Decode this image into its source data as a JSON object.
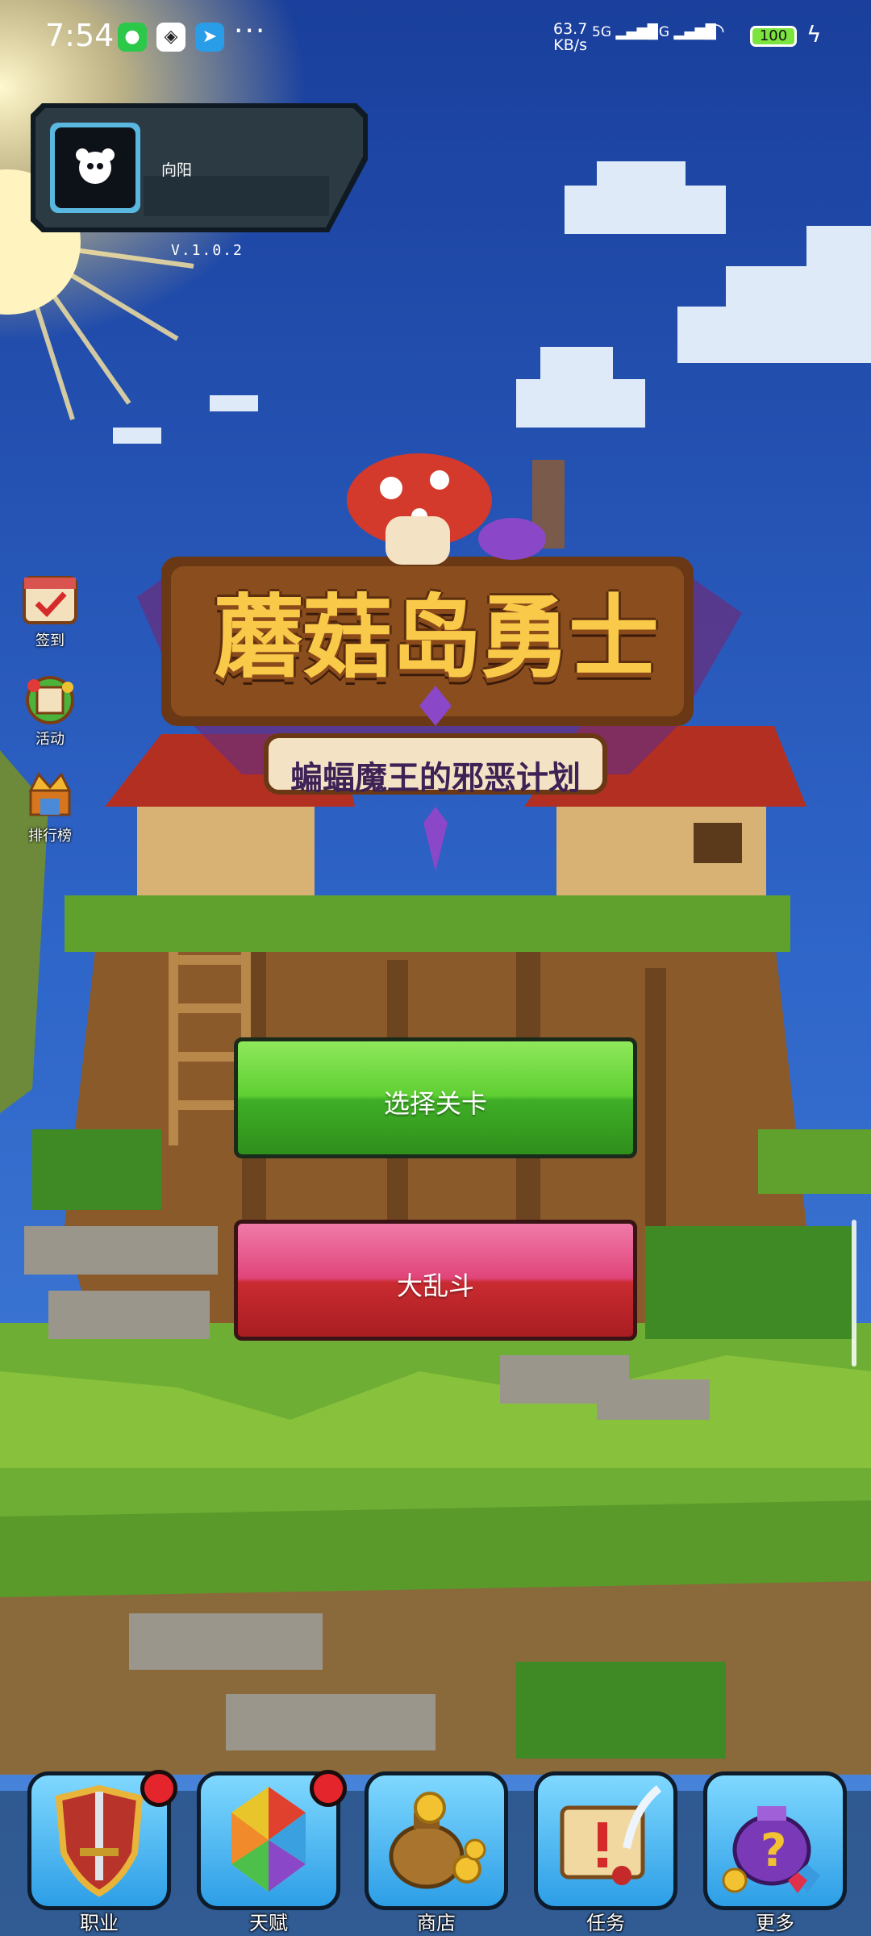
{
  "status_bar": {
    "time": "7:54",
    "network_speed": "63.7",
    "network_unit": "KB/s",
    "sim1": "5G",
    "sim2": "5G",
    "battery": "100",
    "more": "···"
  },
  "profile": {
    "player_name": "向阳",
    "version": "V.1.0.2"
  },
  "side_menu": [
    {
      "label": "签到",
      "icon": "calendar-checkin-icon"
    },
    {
      "label": "活动",
      "icon": "event-map-icon"
    },
    {
      "label": "排行榜",
      "icon": "crown-trophy-icon"
    }
  ],
  "logo": {
    "title": "蘑菇岛勇士",
    "subtitle": "蝙蝠魔王的邪恶计划"
  },
  "buttons": {
    "select_level": "选择关卡",
    "brawl": "大乱斗"
  },
  "bottom_nav": [
    {
      "label": "职业",
      "icon": "shield-sword-icon",
      "has_badge": true
    },
    {
      "label": "天赋",
      "icon": "rainbow-gem-icon",
      "has_badge": true
    },
    {
      "label": "商店",
      "icon": "coin-bag-icon",
      "has_badge": false
    },
    {
      "label": "任务",
      "icon": "scroll-quill-icon",
      "has_badge": false
    },
    {
      "label": "更多",
      "icon": "mystery-bag-icon",
      "has_badge": false
    }
  ],
  "colors": {
    "sky": "#1f4fb4",
    "grass": "#5fa12c",
    "play_button": "#5fcf33",
    "brawl_button": "#d8304a",
    "badge": "#e4262c",
    "nav_tile": "#3aa8ea",
    "title_gold": "#f9c94a"
  }
}
